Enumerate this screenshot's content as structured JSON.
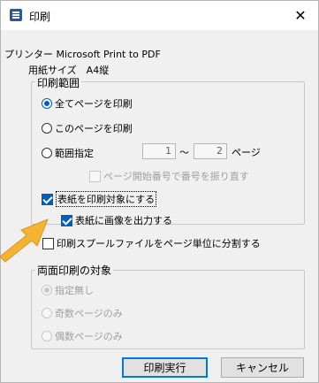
{
  "window": {
    "title": "印刷",
    "close_glyph": "✕"
  },
  "info": {
    "printer": "プリンター Microsoft Print to PDF",
    "paper": "用紙サイズ　A4縦"
  },
  "range_group": {
    "legend": "印刷範囲",
    "options": [
      {
        "label": "全てページを印刷",
        "checked": true
      },
      {
        "label": "このページを印刷",
        "checked": false
      },
      {
        "label": "範囲指定",
        "checked": false
      }
    ],
    "from_value": "1",
    "separator": "～",
    "to_value": "2",
    "page_unit": "ページ",
    "renumber_label": "ページ開始番号で番号を振り直す"
  },
  "cover": {
    "include_cover_label": "表紙を印刷対象にする",
    "cover_image_label": "表紙に画像を出力する"
  },
  "spool": {
    "label": "印刷スプールファイルをページ単位に分割する"
  },
  "duplex_group": {
    "legend": "両面印刷の対象",
    "options": [
      {
        "label": "指定無し",
        "checked": true
      },
      {
        "label": "奇数ページのみ",
        "checked": false
      },
      {
        "label": "偶数ページのみ",
        "checked": false
      }
    ]
  },
  "buttons": {
    "print": "印刷実行",
    "cancel": "キャンセル"
  },
  "colors": {
    "accent": "#005fb8",
    "arrow": "#f5b335"
  }
}
